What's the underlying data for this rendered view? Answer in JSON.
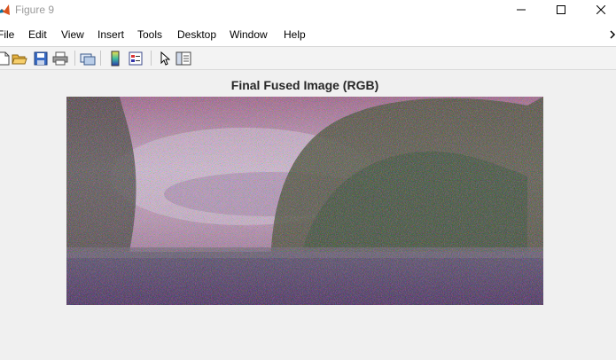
{
  "window": {
    "title": "Figure 9",
    "minimize_label": "Minimize",
    "maximize_label": "Maximize",
    "close_label": "Close"
  },
  "menu": [
    "File",
    "Edit",
    "View",
    "Insert",
    "Tools",
    "Desktop",
    "Window",
    "Help"
  ],
  "toolbar_icons": [
    "new-figure-icon",
    "open-file-icon",
    "save-icon",
    "print-icon",
    "link-plot-icon",
    "insert-colorbar-icon",
    "insert-legend-icon",
    "edit-plot-arrow-icon",
    "property-editor-icon"
  ],
  "figure": {
    "axes_title": "Final Fused Image (RGB)",
    "image_description_colors": {
      "sky": "#c08ab8",
      "tree": "#4a4a3e",
      "ground": "#6b3f7a"
    }
  }
}
